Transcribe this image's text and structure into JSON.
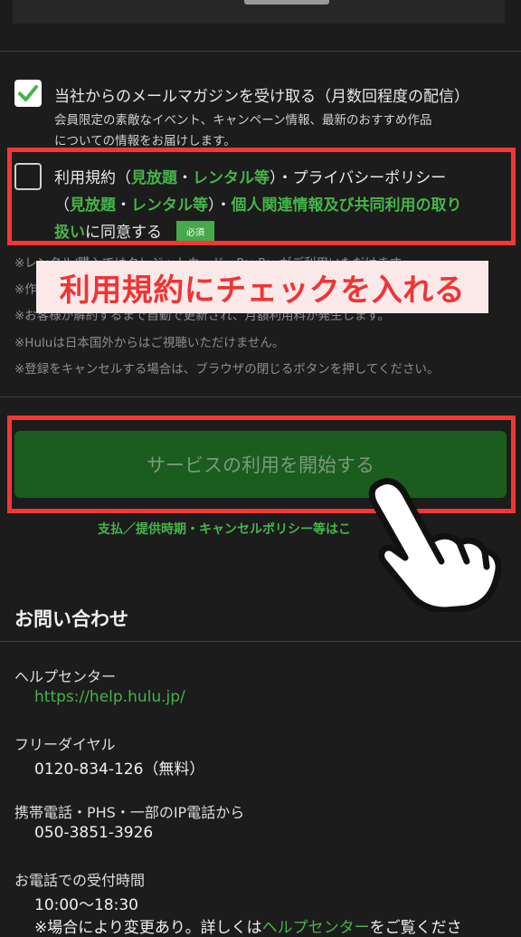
{
  "consent": {
    "newsletter": {
      "checked": true,
      "title": "当社からのメールマガジンを受け取る（月数回程度の配信）",
      "desc_line1": "会員限定の素敵なイベント、キャンペーン情報、最新のおすすめ作品",
      "desc_line2": "についての情報をお届けします。"
    },
    "terms": {
      "checked": false,
      "prefix": "利用規約（",
      "link_mihoudai_1": "見放題",
      "sep_1": "・",
      "link_rental_1": "レンタル等",
      "mid_1": "）・プライバシーポリシー",
      "open_2": "（",
      "link_mihoudai_2": "見放題",
      "sep_2": "・",
      "link_rental_2": "レンタル等",
      "mid_2": "）・",
      "link_personal": "個人関連情報及び共同利用の取り",
      "link_personal_2": "扱い",
      "suffix": "に同意する",
      "required_badge": "必須"
    }
  },
  "notes": {
    "n1": "※レンタル/購入ではクレジットカード・PayPayがご利用いただけます。",
    "n2": "※作",
    "n3": "※お客様が解約するまで自動で更新され、月額利用料が発生します。",
    "n4": "※Huluは日本国外からはご視聴いただけません。",
    "n5": "※登録をキャンセルする場合は、ブラウザの閉じるボタンを押してください。"
  },
  "overlay_text": "利用規約にチェックを入れる",
  "start_button_label": "サービスの利用を開始する",
  "policy_link": "支払／提供時期・キャンセルポリシー等はこ",
  "contact": {
    "title": "お問い合わせ",
    "help_label": "ヘルプセンター",
    "help_url": "https://help.hulu.jp/",
    "free_label": "フリーダイヤル",
    "free_number": "0120-834-126（無料）",
    "mobile_label": "携帯電話・PHS・一部のIP電話から",
    "mobile_number": "050-3851-3926",
    "hours_label": "お電話での受付時間",
    "hours_value": "10:00〜18:30",
    "footnote_prefix": "※場合により変更あり。詳しくは",
    "footnote_link": "ヘルプセンター",
    "footnote_suffix": "をご覧くださ"
  },
  "colors": {
    "accent_green": "#46b44a",
    "button_green": "#1b5c1f",
    "highlight_red": "#f43636",
    "background": "#1b1c1b"
  }
}
